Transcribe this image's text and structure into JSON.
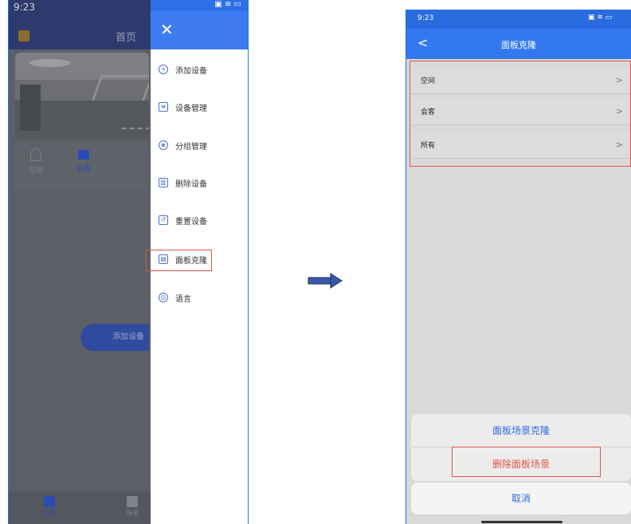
{
  "left_phone": {
    "status_time": "9:23",
    "status_icons": "▣ ≋ ▭",
    "page_title": "首页",
    "tabs": [
      {
        "label": "空间"
      },
      {
        "label": "会客"
      }
    ],
    "add_device_button": "添加设备",
    "bottom_nav": [
      {
        "label": "首页"
      },
      {
        "label": "场景"
      }
    ],
    "drawer": {
      "close_glyph": "✕",
      "items": [
        {
          "label": "添加设备",
          "icon": "plus-circle-icon",
          "glyph": "+"
        },
        {
          "label": "设备管理",
          "icon": "list-icon",
          "glyph": "≡"
        },
        {
          "label": "分组管理",
          "icon": "layers-icon",
          "glyph": "◈"
        },
        {
          "label": "删除设备",
          "icon": "trash-icon",
          "glyph": "▥"
        },
        {
          "label": "重置设备",
          "icon": "reset-icon",
          "glyph": "↺"
        },
        {
          "label": "面板克隆",
          "icon": "panel-icon",
          "glyph": "▤"
        },
        {
          "label": "语言",
          "icon": "globe-icon",
          "glyph": "◎"
        }
      ]
    }
  },
  "arrow": "→",
  "right_phone": {
    "status_time": "9:23",
    "status_icons": "▣ ≋ ▭",
    "back_glyph": "<",
    "title": "面板克隆",
    "rows": [
      {
        "label": "空间",
        "chevron": ">"
      },
      {
        "label": "会客",
        "chevron": ">"
      },
      {
        "label": "所有",
        "chevron": ">"
      }
    ],
    "action_sheet": {
      "clone": "面板场景克隆",
      "delete": "删除面板场景",
      "cancel": "取消"
    }
  },
  "colors": {
    "drawer_header": "#3e7bf0",
    "nav_blue": "#3478f0",
    "highlight_red": "#e0534a",
    "action_blue": "#2f6be0"
  }
}
